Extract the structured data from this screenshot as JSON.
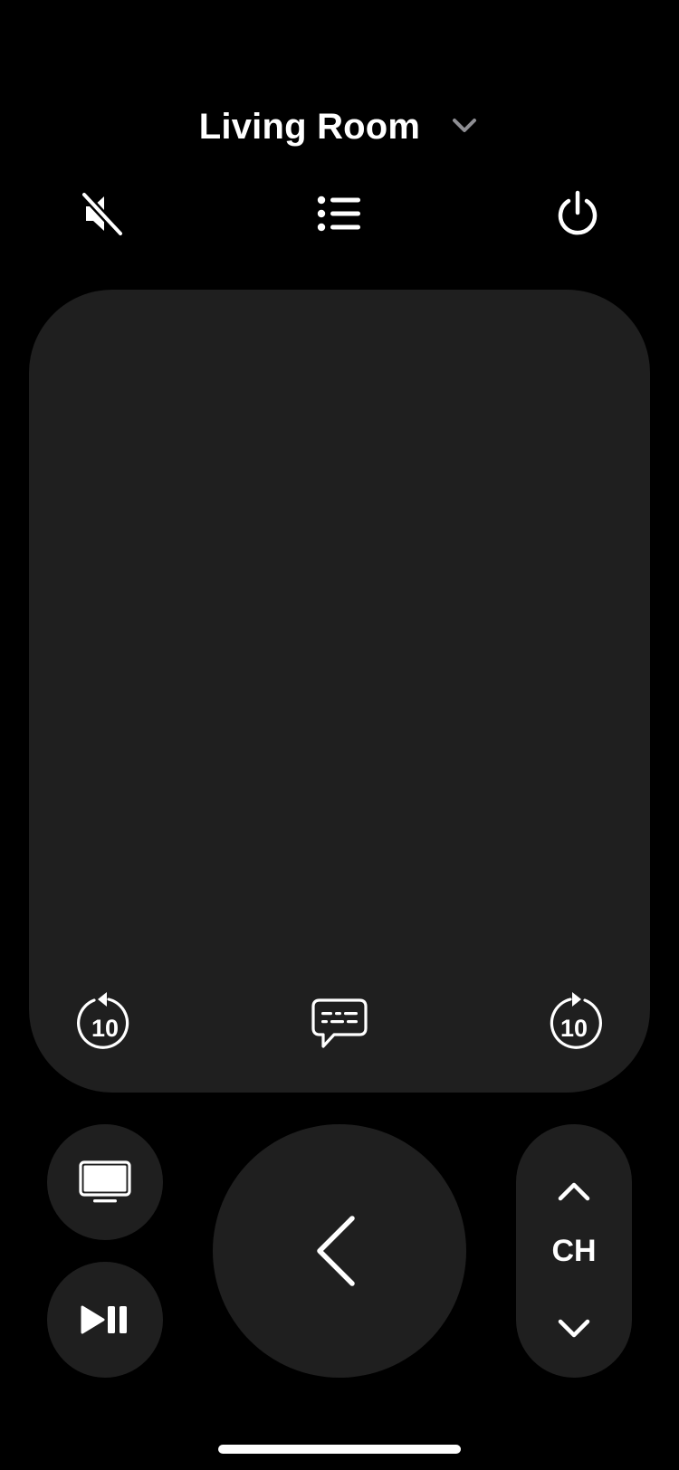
{
  "header": {
    "device_name": "Living Room"
  },
  "top_controls": {
    "mute_icon": "speaker-slash-icon",
    "list_icon": "list-icon",
    "power_icon": "power-icon"
  },
  "touchpad": {
    "skip_back_seconds": "10",
    "skip_forward_seconds": "10",
    "captions_icon": "captions-bubble-icon"
  },
  "bottom_controls": {
    "tv_icon": "tv-icon",
    "play_pause_icon": "play-pause-icon",
    "back_icon": "chevron-left-icon",
    "channel_label": "CH",
    "channel_up_icon": "chevron-up-icon",
    "channel_down_icon": "chevron-down-icon"
  },
  "colors": {
    "background": "#000000",
    "surface": "#1f1f1f",
    "foreground": "#ffffff",
    "secondary": "#8e8e93"
  }
}
